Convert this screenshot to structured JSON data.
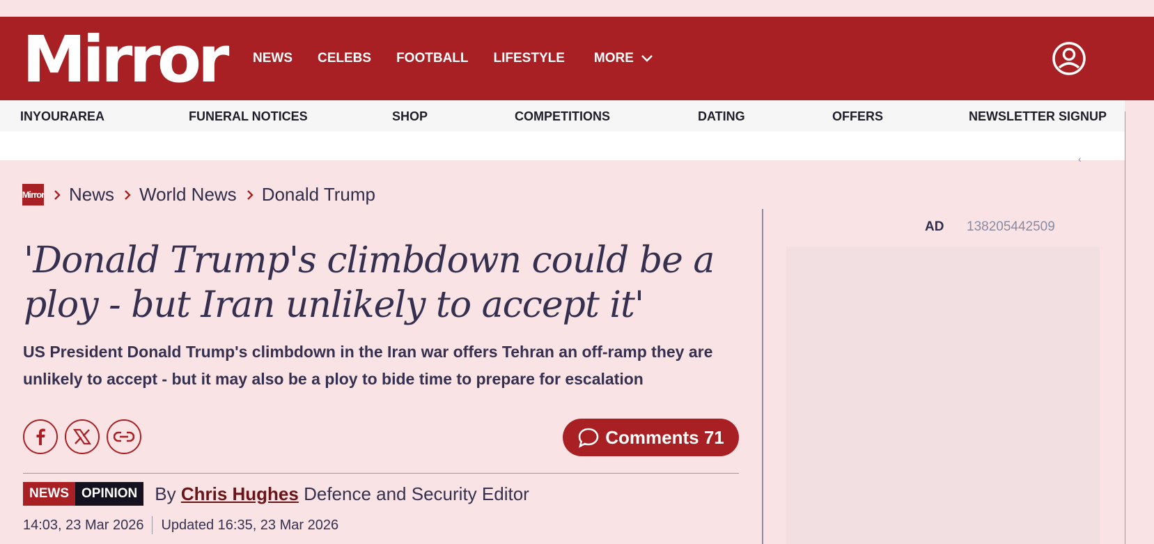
{
  "header": {
    "logo": "Mirror",
    "nav": [
      "NEWS",
      "CELEBS",
      "FOOTBALL",
      "LIFESTYLE"
    ],
    "more_label": "MORE"
  },
  "subnav": [
    "INYOURAREA",
    "FUNERAL NOTICES",
    "SHOP",
    "COMPETITIONS",
    "DATING",
    "OFFERS",
    "NEWSLETTER SIGNUP"
  ],
  "breadcrumb": {
    "logo_text": "Mirror",
    "items": [
      "News",
      "World News",
      "Donald Trump"
    ]
  },
  "article": {
    "headline": "'Donald Trump's climbdown could be a ploy - but Iran unlikely to accept it'",
    "standfirst": "US President Donald Trump's climbdown in the Iran war offers Tehran an off-ramp they are unlikely to accept - but it may also be a ploy to bide time to prepare for escalation",
    "comments_label": "Comments 71",
    "tags": [
      "NEWS",
      "OPINION"
    ],
    "by_prefix": "By",
    "author": "Chris Hughes",
    "author_role": "Defence and Security Editor",
    "published": "14:03, 23 Mar 2026",
    "updated": "Updated 16:35, 23 Mar 2026"
  },
  "ad": {
    "label": "AD",
    "id": "138205442509"
  },
  "colors": {
    "brand_red": "#a82023",
    "page_bg": "#fae3e5",
    "text": "#35304f"
  },
  "icons": [
    "account-icon",
    "chevron-down-icon",
    "chevron-right-icon",
    "facebook-icon",
    "x-icon",
    "link-icon",
    "comment-icon"
  ]
}
